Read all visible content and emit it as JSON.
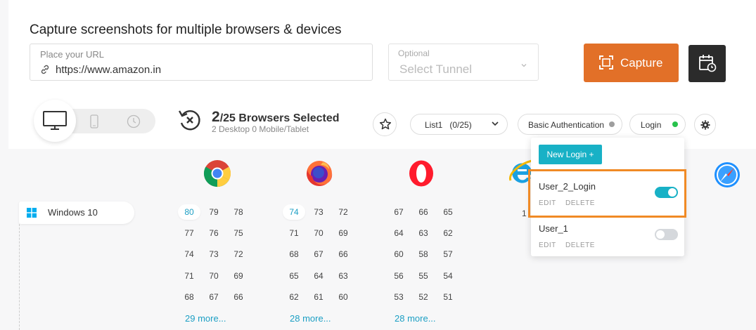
{
  "header": {
    "title": "Capture screenshots for multiple browsers & devices",
    "url_placeholder": "Place your URL",
    "url_value": "https://www.amazon.in",
    "tunnel_label": "Optional",
    "tunnel_value": "Select Tunnel",
    "capture_label": "Capture"
  },
  "selection": {
    "count": "2",
    "total_text": "/25 Browsers Selected",
    "sub": "2 Desktop 0 Mobile/Tablet"
  },
  "toolbar": {
    "list_label": "List1   (0/25)",
    "basic_auth_label": "Basic Authentication",
    "basic_auth_status_color": "#9e9e9e",
    "login_label": "Login",
    "login_status_color": "#27c24c"
  },
  "os": {
    "label": "Windows 10"
  },
  "browsers": {
    "chrome": {
      "versions": [
        "80",
        "79",
        "78",
        "77",
        "76",
        "75",
        "74",
        "73",
        "72",
        "71",
        "70",
        "69",
        "68",
        "67",
        "66"
      ],
      "selected": "80",
      "more": "29 more..."
    },
    "firefox": {
      "versions": [
        "74",
        "73",
        "72",
        "71",
        "70",
        "69",
        "68",
        "67",
        "66",
        "65",
        "64",
        "63",
        "62",
        "61",
        "60"
      ],
      "selected": "74",
      "more": "28 more..."
    },
    "opera": {
      "versions": [
        "67",
        "66",
        "65",
        "64",
        "63",
        "62",
        "60",
        "58",
        "57",
        "56",
        "55",
        "54",
        "53",
        "52",
        "51"
      ],
      "more": "28 more..."
    },
    "ie_partial": "1"
  },
  "login_dropdown": {
    "new_login_label": "New Login +",
    "items": [
      {
        "name": "User_2_Login",
        "edit": "EDIT",
        "delete": "DELETE",
        "enabled": true
      },
      {
        "name": "User_1",
        "edit": "EDIT",
        "delete": "DELETE",
        "enabled": false
      }
    ]
  },
  "colors": {
    "accent": "#e27028",
    "link": "#1c9fc4",
    "toggle_on": "#18b1c6",
    "highlight": "#f08a25"
  }
}
